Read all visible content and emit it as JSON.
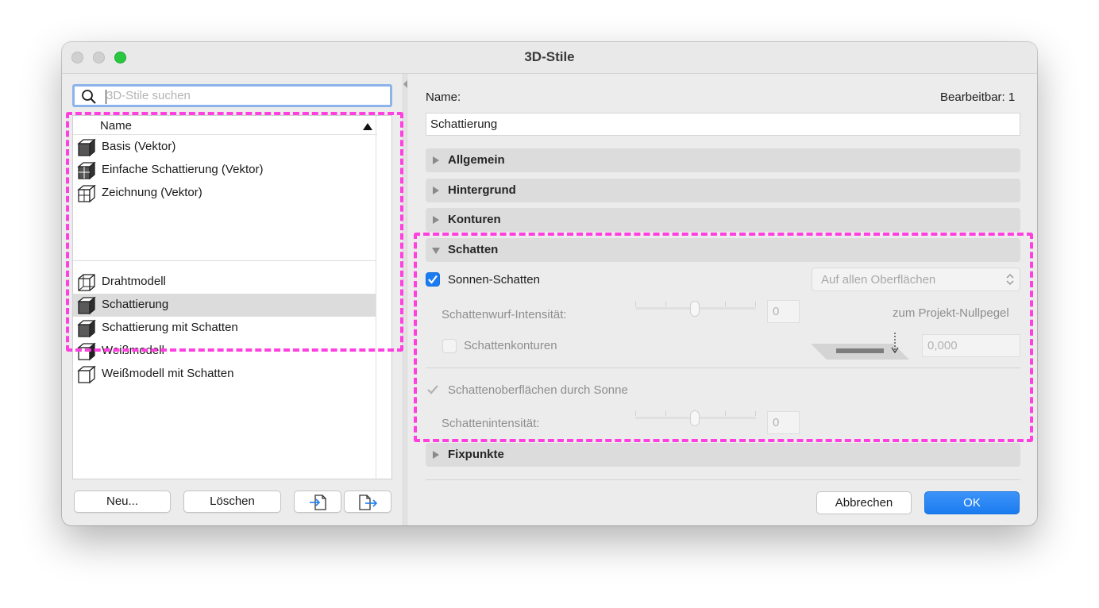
{
  "window": {
    "title": "3D-Stile"
  },
  "search": {
    "placeholder": "3D-Stile suchen",
    "value": ""
  },
  "list": {
    "header": "Name",
    "group1": [
      {
        "label": "Basis (Vektor)",
        "icon": "vector-cube-icon"
      },
      {
        "label": "Einfache Schattierung (Vektor)",
        "icon": "vector-cube-icon"
      },
      {
        "label": "Zeichnung (Vektor)",
        "icon": "vector-cube-icon"
      }
    ],
    "group2": [
      {
        "label": "Drahtmodell",
        "icon": "wireframe-cube-icon"
      },
      {
        "label": "Schattierung",
        "icon": "shaded-cube-icon",
        "selected": true
      },
      {
        "label": "Schattierung mit Schatten",
        "icon": "shaded-cube-icon"
      },
      {
        "label": "Weißmodell",
        "icon": "white-cube-icon"
      },
      {
        "label": "Weißmodell mit Schatten",
        "icon": "white-cube-icon"
      }
    ]
  },
  "left_buttons": {
    "new": "Neu...",
    "delete": "Löschen",
    "import_icon": "import-icon",
    "export_icon": "export-icon"
  },
  "details": {
    "name_label": "Name:",
    "editable": "Bearbeitbar: 1",
    "name_value": "Schattierung",
    "sections": {
      "allgemein": "Allgemein",
      "hintergrund": "Hintergrund",
      "konturen": "Konturen",
      "schatten": "Schatten",
      "fixpunkte": "Fixpunkte"
    },
    "schatten": {
      "sonnen_schatten": "Sonnen-Schatten",
      "surfaces_select": "Auf allen Oberflächen",
      "wurf_intensitaet_label": "Schattenwurf-Intensität:",
      "wurf_intensitaet_value": "0",
      "projekt_nullpegel": "zum Projekt-Nullpegel",
      "schattenkonturen": "Schattenkonturen",
      "nullpegel_value": "0,000",
      "oberflaechen_label": "Schattenoberflächen durch Sonne",
      "intensitaet_label": "Schattenintensität:",
      "intensitaet_value": "0"
    }
  },
  "footer": {
    "cancel": "Abbrechen",
    "ok": "OK"
  },
  "colors": {
    "accent": "#1a7cf0",
    "annotation": "#ff3fe0",
    "zoom": "#2ac840"
  }
}
